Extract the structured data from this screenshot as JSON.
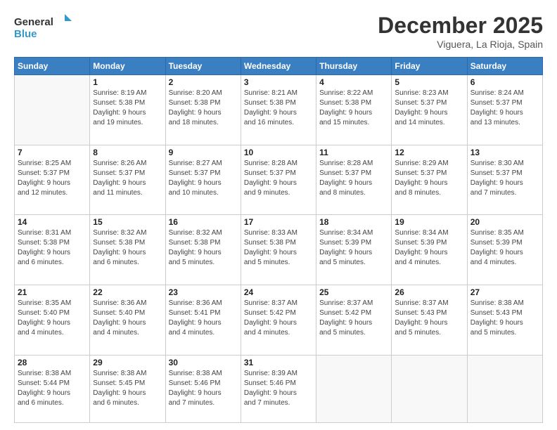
{
  "logo": {
    "line1": "General",
    "line2": "Blue"
  },
  "header": {
    "month": "December 2025",
    "location": "Viguera, La Rioja, Spain"
  },
  "weekdays": [
    "Sunday",
    "Monday",
    "Tuesday",
    "Wednesday",
    "Thursday",
    "Friday",
    "Saturday"
  ],
  "weeks": [
    [
      {
        "day": "",
        "info": ""
      },
      {
        "day": "1",
        "info": "Sunrise: 8:19 AM\nSunset: 5:38 PM\nDaylight: 9 hours\nand 19 minutes."
      },
      {
        "day": "2",
        "info": "Sunrise: 8:20 AM\nSunset: 5:38 PM\nDaylight: 9 hours\nand 18 minutes."
      },
      {
        "day": "3",
        "info": "Sunrise: 8:21 AM\nSunset: 5:38 PM\nDaylight: 9 hours\nand 16 minutes."
      },
      {
        "day": "4",
        "info": "Sunrise: 8:22 AM\nSunset: 5:38 PM\nDaylight: 9 hours\nand 15 minutes."
      },
      {
        "day": "5",
        "info": "Sunrise: 8:23 AM\nSunset: 5:37 PM\nDaylight: 9 hours\nand 14 minutes."
      },
      {
        "day": "6",
        "info": "Sunrise: 8:24 AM\nSunset: 5:37 PM\nDaylight: 9 hours\nand 13 minutes."
      }
    ],
    [
      {
        "day": "7",
        "info": "Sunrise: 8:25 AM\nSunset: 5:37 PM\nDaylight: 9 hours\nand 12 minutes."
      },
      {
        "day": "8",
        "info": "Sunrise: 8:26 AM\nSunset: 5:37 PM\nDaylight: 9 hours\nand 11 minutes."
      },
      {
        "day": "9",
        "info": "Sunrise: 8:27 AM\nSunset: 5:37 PM\nDaylight: 9 hours\nand 10 minutes."
      },
      {
        "day": "10",
        "info": "Sunrise: 8:28 AM\nSunset: 5:37 PM\nDaylight: 9 hours\nand 9 minutes."
      },
      {
        "day": "11",
        "info": "Sunrise: 8:28 AM\nSunset: 5:37 PM\nDaylight: 9 hours\nand 8 minutes."
      },
      {
        "day": "12",
        "info": "Sunrise: 8:29 AM\nSunset: 5:37 PM\nDaylight: 9 hours\nand 8 minutes."
      },
      {
        "day": "13",
        "info": "Sunrise: 8:30 AM\nSunset: 5:37 PM\nDaylight: 9 hours\nand 7 minutes."
      }
    ],
    [
      {
        "day": "14",
        "info": "Sunrise: 8:31 AM\nSunset: 5:38 PM\nDaylight: 9 hours\nand 6 minutes."
      },
      {
        "day": "15",
        "info": "Sunrise: 8:32 AM\nSunset: 5:38 PM\nDaylight: 9 hours\nand 6 minutes."
      },
      {
        "day": "16",
        "info": "Sunrise: 8:32 AM\nSunset: 5:38 PM\nDaylight: 9 hours\nand 5 minutes."
      },
      {
        "day": "17",
        "info": "Sunrise: 8:33 AM\nSunset: 5:38 PM\nDaylight: 9 hours\nand 5 minutes."
      },
      {
        "day": "18",
        "info": "Sunrise: 8:34 AM\nSunset: 5:39 PM\nDaylight: 9 hours\nand 5 minutes."
      },
      {
        "day": "19",
        "info": "Sunrise: 8:34 AM\nSunset: 5:39 PM\nDaylight: 9 hours\nand 4 minutes."
      },
      {
        "day": "20",
        "info": "Sunrise: 8:35 AM\nSunset: 5:39 PM\nDaylight: 9 hours\nand 4 minutes."
      }
    ],
    [
      {
        "day": "21",
        "info": "Sunrise: 8:35 AM\nSunset: 5:40 PM\nDaylight: 9 hours\nand 4 minutes."
      },
      {
        "day": "22",
        "info": "Sunrise: 8:36 AM\nSunset: 5:40 PM\nDaylight: 9 hours\nand 4 minutes."
      },
      {
        "day": "23",
        "info": "Sunrise: 8:36 AM\nSunset: 5:41 PM\nDaylight: 9 hours\nand 4 minutes."
      },
      {
        "day": "24",
        "info": "Sunrise: 8:37 AM\nSunset: 5:42 PM\nDaylight: 9 hours\nand 4 minutes."
      },
      {
        "day": "25",
        "info": "Sunrise: 8:37 AM\nSunset: 5:42 PM\nDaylight: 9 hours\nand 5 minutes."
      },
      {
        "day": "26",
        "info": "Sunrise: 8:37 AM\nSunset: 5:43 PM\nDaylight: 9 hours\nand 5 minutes."
      },
      {
        "day": "27",
        "info": "Sunrise: 8:38 AM\nSunset: 5:43 PM\nDaylight: 9 hours\nand 5 minutes."
      }
    ],
    [
      {
        "day": "28",
        "info": "Sunrise: 8:38 AM\nSunset: 5:44 PM\nDaylight: 9 hours\nand 6 minutes."
      },
      {
        "day": "29",
        "info": "Sunrise: 8:38 AM\nSunset: 5:45 PM\nDaylight: 9 hours\nand 6 minutes."
      },
      {
        "day": "30",
        "info": "Sunrise: 8:38 AM\nSunset: 5:46 PM\nDaylight: 9 hours\nand 7 minutes."
      },
      {
        "day": "31",
        "info": "Sunrise: 8:39 AM\nSunset: 5:46 PM\nDaylight: 9 hours\nand 7 minutes."
      },
      {
        "day": "",
        "info": ""
      },
      {
        "day": "",
        "info": ""
      },
      {
        "day": "",
        "info": ""
      }
    ]
  ]
}
